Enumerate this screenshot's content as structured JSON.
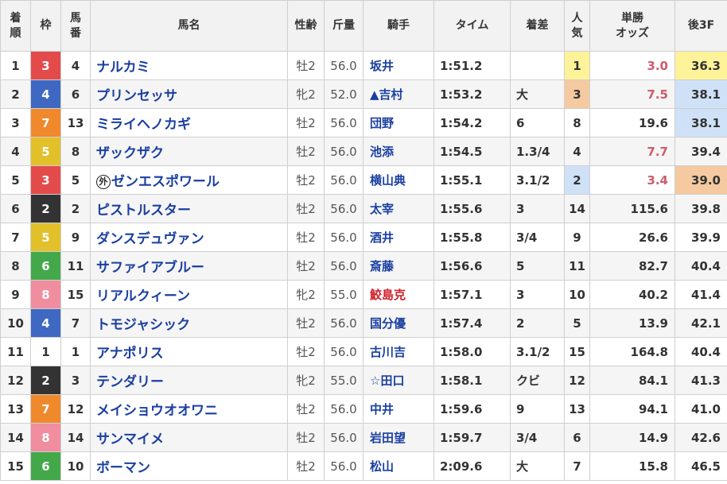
{
  "headers": {
    "rank": [
      "着",
      "順"
    ],
    "frame": "枠",
    "number": [
      "馬",
      "番"
    ],
    "horse": "馬名",
    "sexage": "性齢",
    "weight": "斤量",
    "jockey": "騎手",
    "time": "タイム",
    "margin": "着差",
    "popularity": [
      "人",
      "気"
    ],
    "odds": [
      "単勝",
      "オッズ"
    ],
    "last3f": "後3F"
  },
  "colors": {
    "frame_1": "#ffffff",
    "frame_2": "#333333",
    "frame_3": "#e34b4b",
    "frame_4": "#3e68c2",
    "frame_5": "#e2c02a",
    "frame_6": "#43a84a",
    "frame_7": "#f0882c",
    "frame_8": "#f08ea0",
    "highlight_1st": "#fff39a",
    "highlight_2nd": "#cfe1f7",
    "highlight_3rd": "#f5caa0",
    "horse_name": "#1a3fa0",
    "odds_favorite": "#d05a6a",
    "jockey_female": "#d0202a"
  },
  "rows": [
    {
      "rank": "1",
      "frame": "3",
      "number": "4",
      "mark": "",
      "horse": "ナルカミ",
      "sexage": "牡2",
      "weight": "56.0",
      "jockey": "坂井",
      "time": "1:51.2",
      "margin": "",
      "popularity": "1",
      "odds": "3.0",
      "last3f": "36.3"
    },
    {
      "rank": "2",
      "frame": "4",
      "number": "6",
      "mark": "",
      "horse": "プリンセッサ",
      "sexage": "牝2",
      "weight": "52.0",
      "jockey": "▲吉村",
      "time": "1:53.2",
      "margin": "大",
      "popularity": "3",
      "odds": "7.5",
      "last3f": "38.1"
    },
    {
      "rank": "3",
      "frame": "7",
      "number": "13",
      "mark": "",
      "horse": "ミライヘノカギ",
      "sexage": "牡2",
      "weight": "56.0",
      "jockey": "団野",
      "time": "1:54.2",
      "margin": "6",
      "popularity": "8",
      "odds": "19.6",
      "last3f": "38.1"
    },
    {
      "rank": "4",
      "frame": "5",
      "number": "8",
      "mark": "",
      "horse": "ザックザク",
      "sexage": "牡2",
      "weight": "56.0",
      "jockey": "池添",
      "time": "1:54.5",
      "margin": "1.3/4",
      "popularity": "4",
      "odds": "7.7",
      "last3f": "39.4"
    },
    {
      "rank": "5",
      "frame": "3",
      "number": "5",
      "mark": "外",
      "horse": "ゼンエスポワール",
      "sexage": "牡2",
      "weight": "56.0",
      "jockey": "横山典",
      "time": "1:55.1",
      "margin": "3.1/2",
      "popularity": "2",
      "odds": "3.4",
      "last3f": "39.0"
    },
    {
      "rank": "6",
      "frame": "2",
      "number": "2",
      "mark": "",
      "horse": "ピストルスター",
      "sexage": "牡2",
      "weight": "56.0",
      "jockey": "太宰",
      "time": "1:55.6",
      "margin": "3",
      "popularity": "14",
      "odds": "115.6",
      "last3f": "39.8"
    },
    {
      "rank": "7",
      "frame": "5",
      "number": "9",
      "mark": "",
      "horse": "ダンスデュヴァン",
      "sexage": "牡2",
      "weight": "56.0",
      "jockey": "酒井",
      "time": "1:55.8",
      "margin": "3/4",
      "popularity": "9",
      "odds": "26.6",
      "last3f": "39.9"
    },
    {
      "rank": "8",
      "frame": "6",
      "number": "11",
      "mark": "",
      "horse": "サファイアブルー",
      "sexage": "牡2",
      "weight": "56.0",
      "jockey": "斎藤",
      "time": "1:56.6",
      "margin": "5",
      "popularity": "11",
      "odds": "82.7",
      "last3f": "40.4"
    },
    {
      "rank": "9",
      "frame": "8",
      "number": "15",
      "mark": "",
      "horse": "リアルクィーン",
      "sexage": "牝2",
      "weight": "55.0",
      "jockey": "鮫島克",
      "time": "1:57.1",
      "margin": "3",
      "popularity": "10",
      "odds": "40.2",
      "last3f": "41.4"
    },
    {
      "rank": "10",
      "frame": "4",
      "number": "7",
      "mark": "",
      "horse": "トモジャシック",
      "sexage": "牡2",
      "weight": "56.0",
      "jockey": "国分優",
      "time": "1:57.4",
      "margin": "2",
      "popularity": "5",
      "odds": "13.9",
      "last3f": "42.1"
    },
    {
      "rank": "11",
      "frame": "1",
      "number": "1",
      "mark": "",
      "horse": "アナポリス",
      "sexage": "牡2",
      "weight": "56.0",
      "jockey": "古川吉",
      "time": "1:58.0",
      "margin": "3.1/2",
      "popularity": "15",
      "odds": "164.8",
      "last3f": "40.4"
    },
    {
      "rank": "12",
      "frame": "2",
      "number": "3",
      "mark": "",
      "horse": "テンダリー",
      "sexage": "牝2",
      "weight": "55.0",
      "jockey": "☆田口",
      "time": "1:58.1",
      "margin": "クビ",
      "popularity": "12",
      "odds": "84.1",
      "last3f": "41.3"
    },
    {
      "rank": "13",
      "frame": "7",
      "number": "12",
      "mark": "",
      "horse": "メイショウオオワニ",
      "sexage": "牡2",
      "weight": "56.0",
      "jockey": "中井",
      "time": "1:59.6",
      "margin": "9",
      "popularity": "13",
      "odds": "94.1",
      "last3f": "41.0"
    },
    {
      "rank": "14",
      "frame": "8",
      "number": "14",
      "mark": "",
      "horse": "サンマイメ",
      "sexage": "牡2",
      "weight": "56.0",
      "jockey": "岩田望",
      "time": "1:59.7",
      "margin": "3/4",
      "popularity": "6",
      "odds": "14.9",
      "last3f": "42.6"
    },
    {
      "rank": "15",
      "frame": "6",
      "number": "10",
      "mark": "",
      "horse": "ボーマン",
      "sexage": "牡2",
      "weight": "56.0",
      "jockey": "松山",
      "time": "2:09.6",
      "margin": "大",
      "popularity": "7",
      "odds": "15.8",
      "last3f": "46.5"
    }
  ]
}
